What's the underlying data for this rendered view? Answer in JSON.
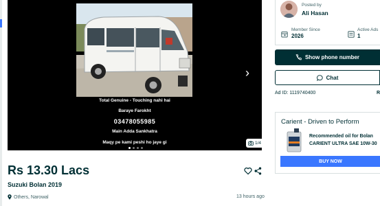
{
  "gallery": {
    "captions": [
      "Total Genuine - Touching nahi hai",
      "Baraye Farokht",
      "03478055985",
      "Main Adda Sankhatra",
      "Maqy pe kami peshi ho jaye gi"
    ],
    "counter": "1/4",
    "current_image": 1,
    "total_images": 4
  },
  "listing": {
    "price": "Rs 13.30 Lacs",
    "title": "Suzuki Bolan 2019",
    "location": "Others, Narowal",
    "posted_ago": "13 hours ago"
  },
  "seller": {
    "posted_by_label": "Posted by",
    "name": "Ali Hasan",
    "member_since_label": "Member Since",
    "member_since": "2026",
    "active_ads_label": "Active Ads",
    "active_ads": "1"
  },
  "actions": {
    "phone_label": "Show phone number",
    "chat_label": "Chat"
  },
  "ad": {
    "id_text": "Ad ID: 1119740400",
    "report_label": "R"
  },
  "promo": {
    "title": "Carient - Driven to Perform",
    "line1": "Recommended oil for Bolan",
    "line2": "CARIENT ULTRA SAE 10W-30",
    "cta": "BUY NOW"
  },
  "colors": {
    "primary_dark": "#002f34",
    "accent_blue": "#3a77ff"
  }
}
